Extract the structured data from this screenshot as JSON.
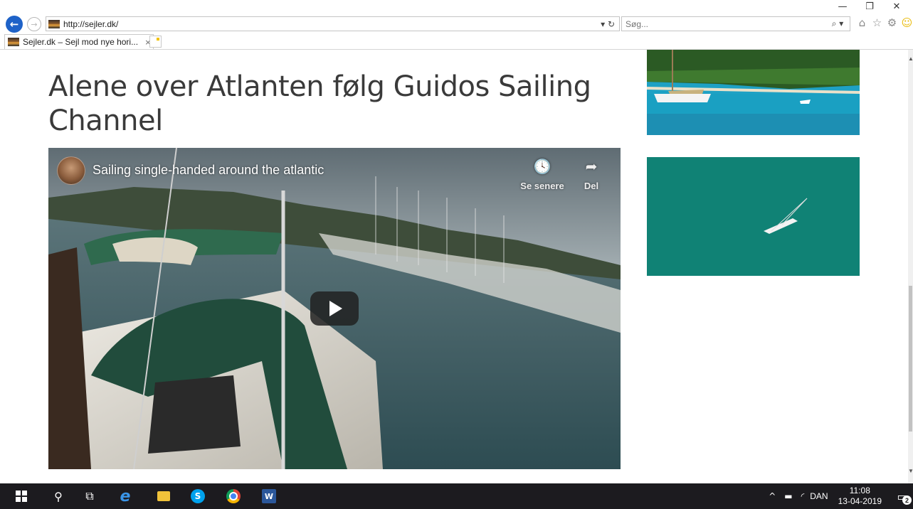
{
  "browser": {
    "window_controls": {
      "minimize": "—",
      "restore": "❐",
      "close": "✕"
    },
    "address": {
      "url": "http://sejler.dk/",
      "dropdown": "▾",
      "refresh": "↻"
    },
    "search": {
      "placeholder": "Søg...",
      "search_icon": "⌕",
      "dropdown": "▾"
    },
    "toolbar_icons": [
      {
        "name": "home-icon",
        "glyph": "⌂"
      },
      {
        "name": "favorites-icon",
        "glyph": "☆"
      },
      {
        "name": "settings-icon",
        "glyph": "⚙"
      },
      {
        "name": "feedback-icon",
        "glyph": "☺"
      }
    ],
    "tab": {
      "title": "Sejler.dk – Sejl mod nye hori...",
      "close": "×"
    }
  },
  "page": {
    "headline": "Alene over Atlanten følg Guidos Sailing Channel",
    "video": {
      "title": "Sailing single-handed around the atlantic",
      "watch_later_icon": "🕓",
      "watch_later_label": "Se senere",
      "share_icon": "➦",
      "share_label": "Del"
    }
  },
  "taskbar": {
    "apps": [
      {
        "name": "windows-start-icon"
      },
      {
        "name": "search-icon",
        "glyph": "⚲"
      },
      {
        "name": "task-view-icon",
        "glyph": "⧉"
      },
      {
        "name": "internet-explorer-icon",
        "glyph": "e"
      },
      {
        "name": "file-explorer-icon"
      },
      {
        "name": "skype-icon",
        "glyph": "S"
      },
      {
        "name": "chrome-icon"
      },
      {
        "name": "word-icon",
        "glyph": "W"
      }
    ],
    "tray": {
      "chevron": "^",
      "battery_glyph": "▬",
      "wifi_glyph": "◜",
      "language": "DAN",
      "time": "11:08",
      "date": "13-04-2019",
      "notifications_count": "2"
    }
  },
  "colors": {
    "accent_blue": "#1e62c8",
    "taskbar": "#1c1b1f",
    "headline": "#3a3a3a"
  }
}
